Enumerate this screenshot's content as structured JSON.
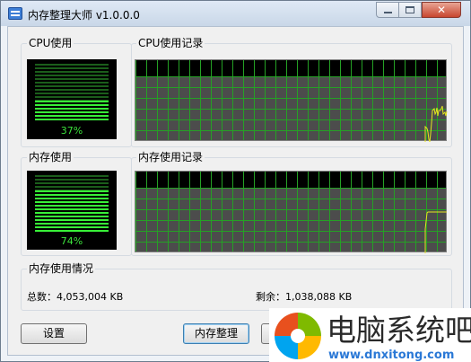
{
  "window": {
    "title": "内存整理大师 v1.0.0.0",
    "close_glyph": "✕"
  },
  "cpu": {
    "meter_label": "CPU使用",
    "percent_text": "37%",
    "percent": 37,
    "history_label": "CPU使用记录"
  },
  "memory": {
    "meter_label": "内存使用",
    "percent_text": "74%",
    "percent": 74,
    "history_label": "内存使用记录"
  },
  "memory_info": {
    "section_label": "内存使用情况",
    "total_text": "总数：4,053,004 KB",
    "free_text": "剩余：1,038,088 KB"
  },
  "buttons": {
    "settings_label": "设置",
    "clean_label": "内存整理"
  },
  "watermark": {
    "text": "电脑系统吧",
    "url": "www.dnxitong.com"
  },
  "colors": {
    "graph_line": "#e6e61e",
    "grid": "#25a125",
    "meter_on": "#38f038",
    "meter_off": "#1b5e1b"
  }
}
